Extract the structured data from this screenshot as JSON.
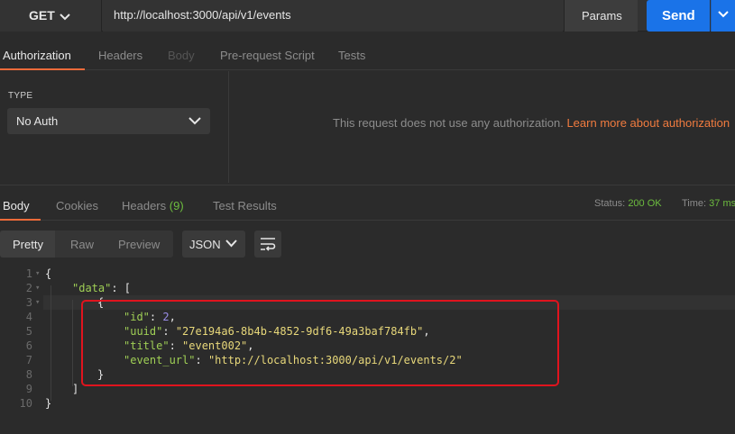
{
  "request": {
    "method": "GET",
    "url": "http://localhost:3000/api/v1/events",
    "params_label": "Params",
    "send_label": "Send"
  },
  "request_tabs": [
    {
      "label": "Authorization",
      "state": "active"
    },
    {
      "label": "Headers",
      "state": "normal"
    },
    {
      "label": "Body",
      "state": "disabled"
    },
    {
      "label": "Pre-request Script",
      "state": "normal"
    },
    {
      "label": "Tests",
      "state": "normal"
    }
  ],
  "auth": {
    "type_label": "TYPE",
    "selected": "No Auth",
    "message": "This request does not use any authorization.",
    "link": "Learn more about authorization"
  },
  "response_tabs": {
    "body": "Body",
    "cookies": "Cookies",
    "headers": "Headers",
    "headers_count": "(9)",
    "test_results": "Test Results"
  },
  "status": {
    "status_label": "Status:",
    "status_value": "200 OK",
    "time_label": "Time:",
    "time_value": "37 ms"
  },
  "view": {
    "modes": [
      "Pretty",
      "Raw",
      "Preview"
    ],
    "active_mode": "Pretty",
    "format": "JSON"
  },
  "code_lines": [
    {
      "n": "1",
      "text": "{"
    },
    {
      "n": "2",
      "key": "\"data\"",
      "rest": ": ["
    },
    {
      "n": "3",
      "text": "{"
    },
    {
      "n": "4",
      "key": "\"id\"",
      "sep": ": ",
      "num": "2",
      "end": ","
    },
    {
      "n": "5",
      "key": "\"uuid\"",
      "sep": ": ",
      "str": "\"27e194a6-8b4b-4852-9df6-49a3baf784fb\"",
      "end": ","
    },
    {
      "n": "6",
      "key": "\"title\"",
      "sep": ": ",
      "str": "\"event002\"",
      "end": ","
    },
    {
      "n": "7",
      "key": "\"event_url\"",
      "sep": ": ",
      "str": "\"http://localhost:3000/api/v1/events/2\"",
      "end": ""
    },
    {
      "n": "8",
      "text": "}"
    },
    {
      "n": "9",
      "text": "]"
    },
    {
      "n": "10",
      "text": "}"
    }
  ],
  "colors": {
    "accent": "#f26b3a",
    "send": "#1a73e8",
    "status_ok": "#6dbd3f",
    "highlight_box": "#e0141e"
  }
}
